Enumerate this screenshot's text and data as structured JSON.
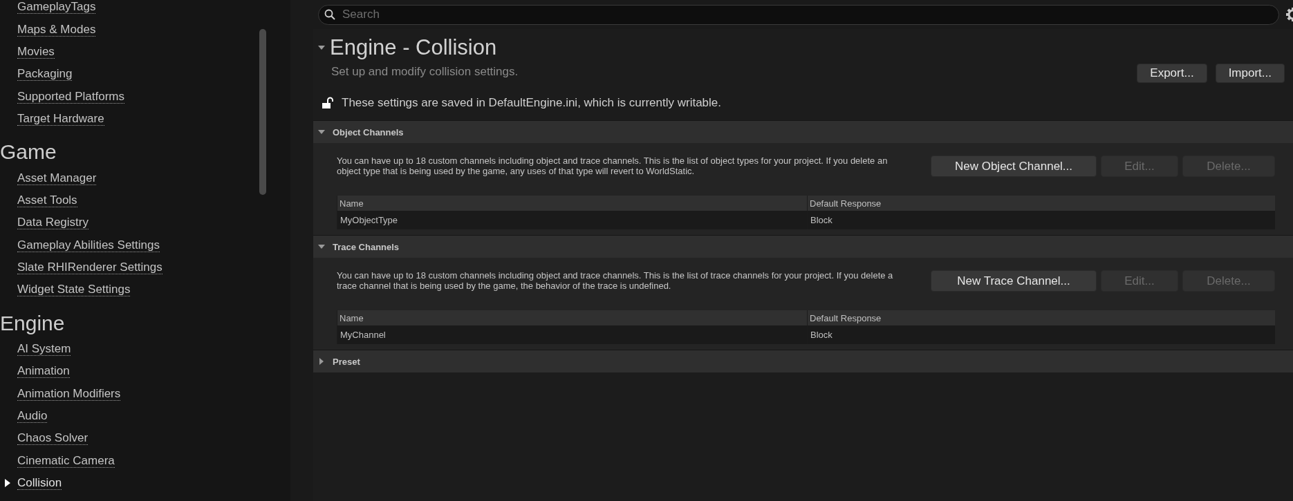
{
  "sidebar": {
    "sections": [
      {
        "items": [
          {
            "label": "GameplayTags",
            "selected": false
          },
          {
            "label": "Maps & Modes",
            "selected": false
          },
          {
            "label": "Movies",
            "selected": false
          },
          {
            "label": "Packaging",
            "selected": false
          },
          {
            "label": "Supported Platforms",
            "selected": false
          },
          {
            "label": "Target Hardware",
            "selected": false
          }
        ]
      },
      {
        "heading": "Game",
        "items": [
          {
            "label": "Asset Manager",
            "selected": false
          },
          {
            "label": "Asset Tools",
            "selected": false
          },
          {
            "label": "Data Registry",
            "selected": false
          },
          {
            "label": "Gameplay Abilities Settings",
            "selected": false
          },
          {
            "label": "Slate RHIRenderer Settings",
            "selected": false
          },
          {
            "label": "Widget State Settings",
            "selected": false
          }
        ]
      },
      {
        "heading": "Engine",
        "items": [
          {
            "label": "AI System",
            "selected": false
          },
          {
            "label": "Animation",
            "selected": false
          },
          {
            "label": "Animation Modifiers",
            "selected": false
          },
          {
            "label": "Audio",
            "selected": false
          },
          {
            "label": "Chaos Solver",
            "selected": false
          },
          {
            "label": "Cinematic Camera",
            "selected": false
          },
          {
            "label": "Collision",
            "selected": true
          }
        ]
      }
    ]
  },
  "search": {
    "placeholder": "Search"
  },
  "page": {
    "title": "Engine - Collision",
    "expanded": true,
    "subtitle": "Set up and modify collision settings.",
    "buttons": [
      {
        "label": "Export..."
      },
      {
        "label": "Import..."
      }
    ],
    "notice": "These settings are saved in DefaultEngine.ini, which is currently writable.",
    "locked": false
  },
  "categories": [
    {
      "title": "Object Channels",
      "expanded": true,
      "description": "You can have up to 18 custom channels including object and trace channels. This is the list of object types for your project. If you delete an object type that is being used by the game, any uses of that type will revert to WorldStatic.",
      "buttons": [
        {
          "label": "New Object Channel...",
          "disabled": false
        },
        {
          "label": "Edit...",
          "disabled": true
        },
        {
          "label": "Delete...",
          "disabled": true
        }
      ],
      "columns": [
        "Name",
        "Default Response"
      ],
      "rows": [
        [
          "MyObjectType",
          "Block"
        ]
      ]
    },
    {
      "title": "Trace Channels",
      "expanded": true,
      "description": "You can have up to 18 custom channels including object and trace channels. This is the list of trace channels for your project. If you delete a trace channel that is being used by the game, the behavior of the trace is undefined.",
      "buttons": [
        {
          "label": "New Trace Channel...",
          "disabled": false
        },
        {
          "label": "Edit...",
          "disabled": true
        },
        {
          "label": "Delete...",
          "disabled": true
        }
      ],
      "columns": [
        "Name",
        "Default Response"
      ],
      "rows": [
        [
          "MyChannel",
          "Block"
        ]
      ]
    },
    {
      "title": "Preset",
      "expanded": false
    }
  ]
}
